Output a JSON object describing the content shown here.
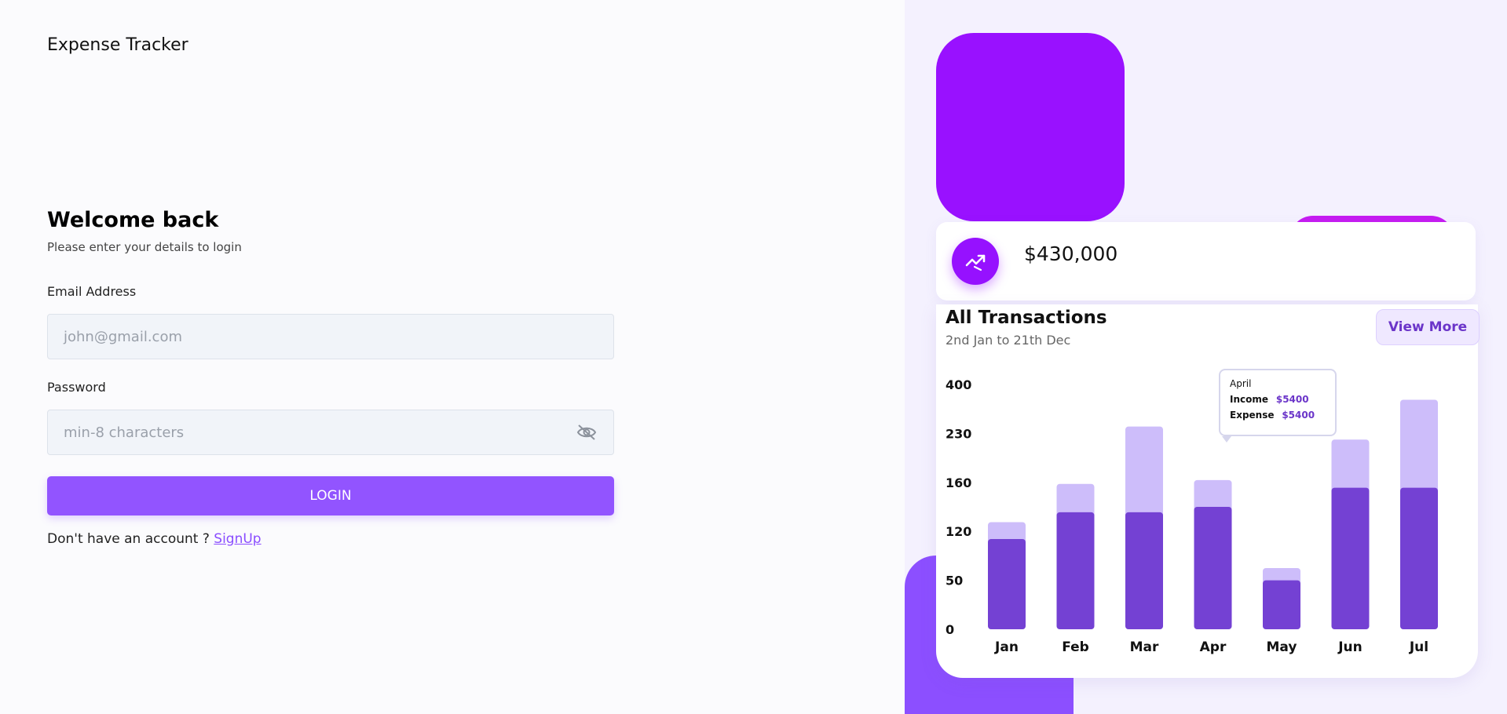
{
  "app": {
    "brand": "Expense Tracker"
  },
  "login": {
    "title": "Welcome back",
    "subtitle": "Please enter your details to login",
    "email_label": "Email Address",
    "email_placeholder": "john@gmail.com",
    "password_label": "Password",
    "password_placeholder": "min-8 characters",
    "password_icon": "eye-off-icon",
    "login_label": "LOGIN",
    "signup_prompt": "Don't have an account ? ",
    "signup_link": "SignUp"
  },
  "stat": {
    "icon": "trending-up-icon",
    "value": "$430,000"
  },
  "transactions": {
    "title": "All Transactions",
    "range": "2nd Jan to 21th Dec",
    "view_more": "View More",
    "tooltip": {
      "month": "April",
      "income_label": "Income",
      "income_value": "$5400",
      "expense_label": "Expense",
      "expense_value": "$5400"
    }
  },
  "colors": {
    "accent": "#9254ff",
    "brand_purple": "#9911ff",
    "pink": "#c61cf1",
    "bar_dark": "#7441d3",
    "bar_light": "#cdbdfa"
  },
  "chart_data": {
    "type": "bar",
    "categories": [
      "Jan",
      "Feb",
      "Mar",
      "Apr",
      "May",
      "Jun",
      "Jul"
    ],
    "y_ticks": [
      "400",
      "230",
      "160",
      "120",
      "50",
      "0"
    ],
    "series": [
      {
        "values": [
          118,
          153,
          153,
          160,
          64,
          185,
          185
        ]
      },
      {
        "values": [
          140,
          190,
          265,
          195,
          80,
          248,
          300
        ]
      }
    ],
    "grid": false
  }
}
